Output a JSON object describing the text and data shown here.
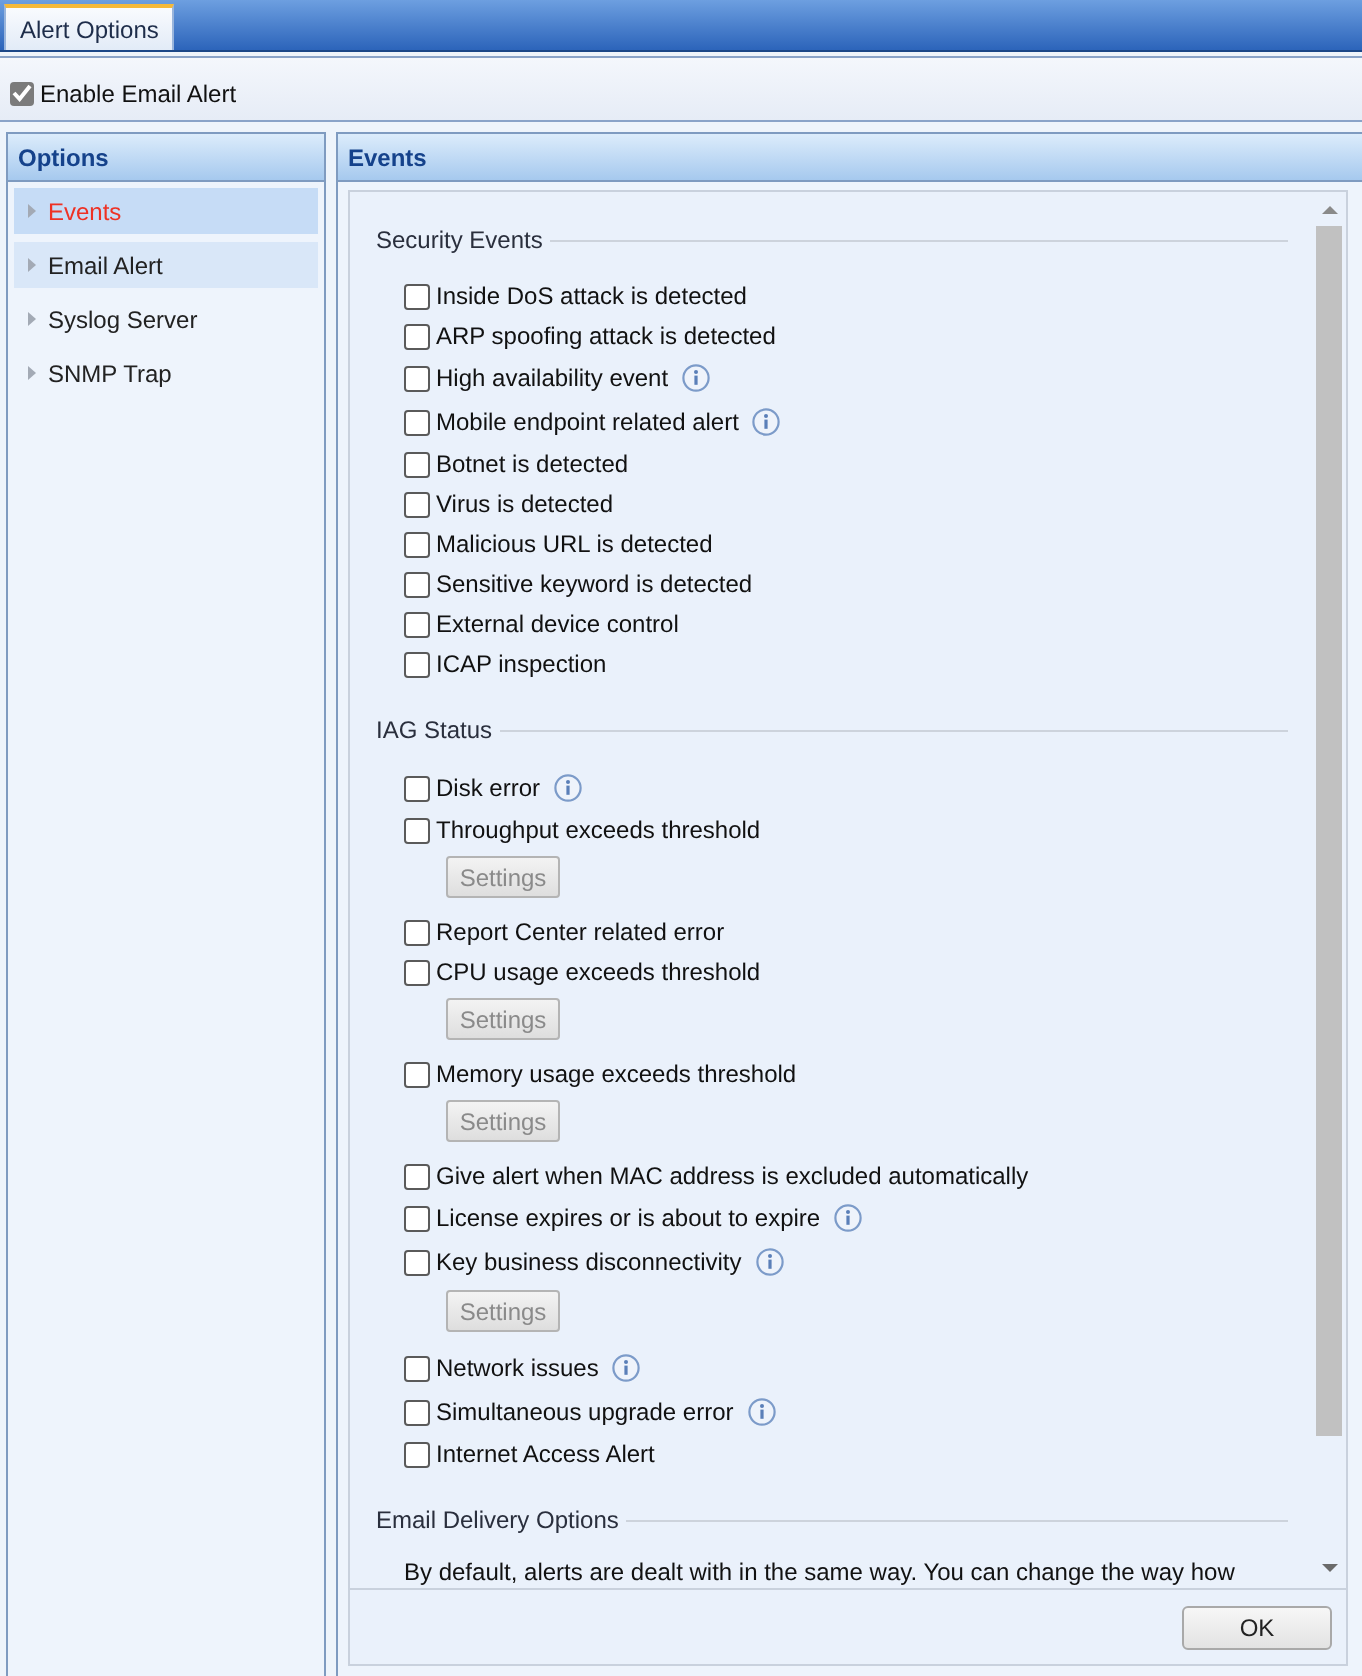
{
  "tab_bar": {
    "tabs": [
      {
        "label": "Alert Options",
        "selected": true
      }
    ]
  },
  "toolbar": {
    "enable_email_alert": {
      "label": "Enable Email Alert",
      "checked": true
    }
  },
  "sidebar": {
    "title": "Options",
    "items": [
      {
        "label": "Events",
        "selected": true,
        "hovered": false
      },
      {
        "label": "Email Alert",
        "selected": false,
        "hovered": true
      },
      {
        "label": "Syslog Server",
        "selected": false,
        "hovered": false
      },
      {
        "label": "SNMP Trap",
        "selected": false,
        "hovered": false
      }
    ]
  },
  "events_panel": {
    "title": "Events",
    "sections": [
      {
        "kind": "checklist",
        "title": "Security Events",
        "items": [
          {
            "label": "Inside DoS attack is detected",
            "checked": false
          },
          {
            "label": "ARP spoofing attack is detected",
            "checked": false
          },
          {
            "label": "High availability event",
            "checked": false,
            "info": true
          },
          {
            "label": "Mobile endpoint related alert",
            "checked": false,
            "info": true
          },
          {
            "label": "Botnet is detected",
            "checked": false
          },
          {
            "label": "Virus is detected",
            "checked": false
          },
          {
            "label": "Malicious URL is detected",
            "checked": false
          },
          {
            "label": "Sensitive keyword is detected",
            "checked": false
          },
          {
            "label": "External device control",
            "checked": false
          },
          {
            "label": "ICAP inspection",
            "checked": false
          }
        ]
      },
      {
        "kind": "checklist",
        "title": "IAG Status",
        "items": [
          {
            "label": "Disk error",
            "checked": false,
            "info": true
          },
          {
            "label": "Throughput exceeds threshold",
            "checked": false,
            "settings": {
              "label": "Settings",
              "disabled": true
            }
          },
          {
            "label": "Report Center related error",
            "checked": false
          },
          {
            "label": "CPU usage exceeds threshold",
            "checked": false,
            "settings": {
              "label": "Settings",
              "disabled": true
            }
          },
          {
            "label": "Memory usage exceeds threshold",
            "checked": false,
            "settings": {
              "label": "Settings",
              "disabled": true
            }
          },
          {
            "label": "Give alert when MAC address is excluded automatically",
            "checked": false
          },
          {
            "label": "License expires or is about to expire",
            "checked": false,
            "info": true
          },
          {
            "label": "Key business disconnectivity",
            "checked": false,
            "info": true,
            "settings": {
              "label": "Settings",
              "disabled": true
            }
          },
          {
            "label": "Network issues",
            "checked": false,
            "info": true
          },
          {
            "label": "Simultaneous upgrade error",
            "checked": false,
            "info": true
          },
          {
            "label": "Internet Access Alert",
            "checked": false
          }
        ]
      },
      {
        "kind": "text",
        "title": "Email Delivery Options",
        "text": "By default, alerts are dealt with in the same way. You can change the way how"
      }
    ],
    "ok_button": "OK"
  }
}
